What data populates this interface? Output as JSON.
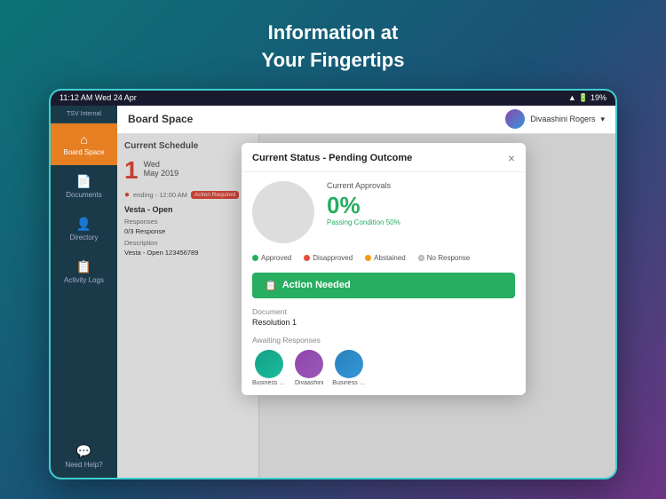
{
  "hero": {
    "line1": "Information at",
    "line2": "Your Fingertips"
  },
  "statusBar": {
    "time": "11:12 AM  Wed 24 Apr",
    "battery": "19%"
  },
  "sidebar": {
    "appName": "TSV Internal",
    "items": [
      {
        "id": "board-space",
        "label": "Board Space",
        "icon": "⌂",
        "active": true
      },
      {
        "id": "documents",
        "label": "Documents",
        "icon": "📄",
        "active": false
      },
      {
        "id": "directory",
        "label": "Directory",
        "icon": "👤",
        "active": false
      },
      {
        "id": "activity-logs",
        "label": "Activity Logs",
        "icon": "📋",
        "active": false
      }
    ],
    "bottomItems": [
      {
        "id": "need-help",
        "label": "Need Help?",
        "icon": "💬"
      }
    ]
  },
  "topNav": {
    "title": "Board Space",
    "user": "Divaashini Rogers"
  },
  "schedule": {
    "title": "Current Schedule",
    "date": {
      "day": "1",
      "weekday": "Wed",
      "month": "May 2019"
    },
    "event": {
      "timeLabel": "ending - 12:00 AM",
      "actionRequired": "Action Required",
      "title": "Vesta - Open",
      "responsesLabel": "Responses",
      "responsesValue": "0/3 Response",
      "descriptionLabel": "Description",
      "descriptionValue": "Vesta - Open 123456789"
    }
  },
  "modal": {
    "title": "Current Status - Pending Outcome",
    "closeLabel": "×",
    "approvals": {
      "label": "Current Approvals",
      "percentage": "0%",
      "passingCondition": "Passing Condition 50%"
    },
    "legend": [
      {
        "label": "Approved",
        "color": "#27ae60"
      },
      {
        "label": "Disapproved",
        "color": "#e74c3c"
      },
      {
        "label": "Abstained",
        "color": "#f39c12"
      },
      {
        "label": "No Response",
        "color": "#ccc"
      }
    ],
    "actionButton": {
      "label": "Action Needed",
      "icon": "📋"
    },
    "document": {
      "label": "Document",
      "value": "Resolution 1"
    },
    "awaiting": {
      "label": "Awaiting Responses",
      "avatars": [
        {
          "name": "Business Tec...",
          "colorClass": "av1"
        },
        {
          "name": "Divaashini",
          "colorClass": "av2"
        },
        {
          "name": "Business + A...",
          "colorClass": "av3"
        }
      ]
    }
  }
}
